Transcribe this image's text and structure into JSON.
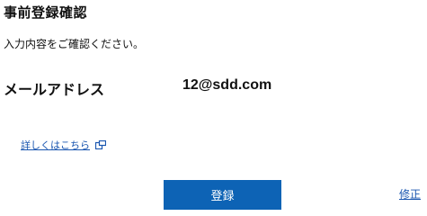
{
  "page": {
    "title": "事前登録確認",
    "instruction": "入力内容をご確認ください。"
  },
  "form": {
    "email_label": "メールアドレス",
    "email_value": "12@sdd.com"
  },
  "links": {
    "details": "詳しくはこちら",
    "details_icon": "external-link-icon",
    "edit": "修正"
  },
  "actions": {
    "register_label": "登録"
  },
  "colors": {
    "primary_button": "#0d63b5",
    "link": "#1a56b0"
  }
}
